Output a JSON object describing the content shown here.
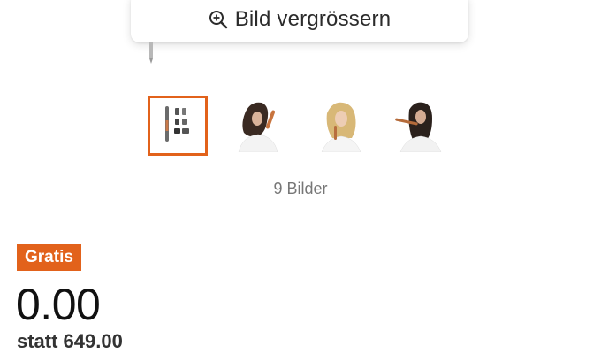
{
  "zoom": {
    "label": "Bild vergrössern",
    "icon": "zoom-in-icon"
  },
  "gallery": {
    "thumbnails": [
      {
        "name": "thumb-product-set",
        "active": true
      },
      {
        "name": "thumb-model-1",
        "active": false
      },
      {
        "name": "thumb-model-2",
        "active": false
      },
      {
        "name": "thumb-model-3",
        "active": false
      }
    ],
    "count_label": "9 Bilder"
  },
  "pricing": {
    "badge": "Gratis",
    "price": "0.00",
    "old_price": "statt 649.00"
  },
  "colors": {
    "accent": "#e2621b"
  }
}
